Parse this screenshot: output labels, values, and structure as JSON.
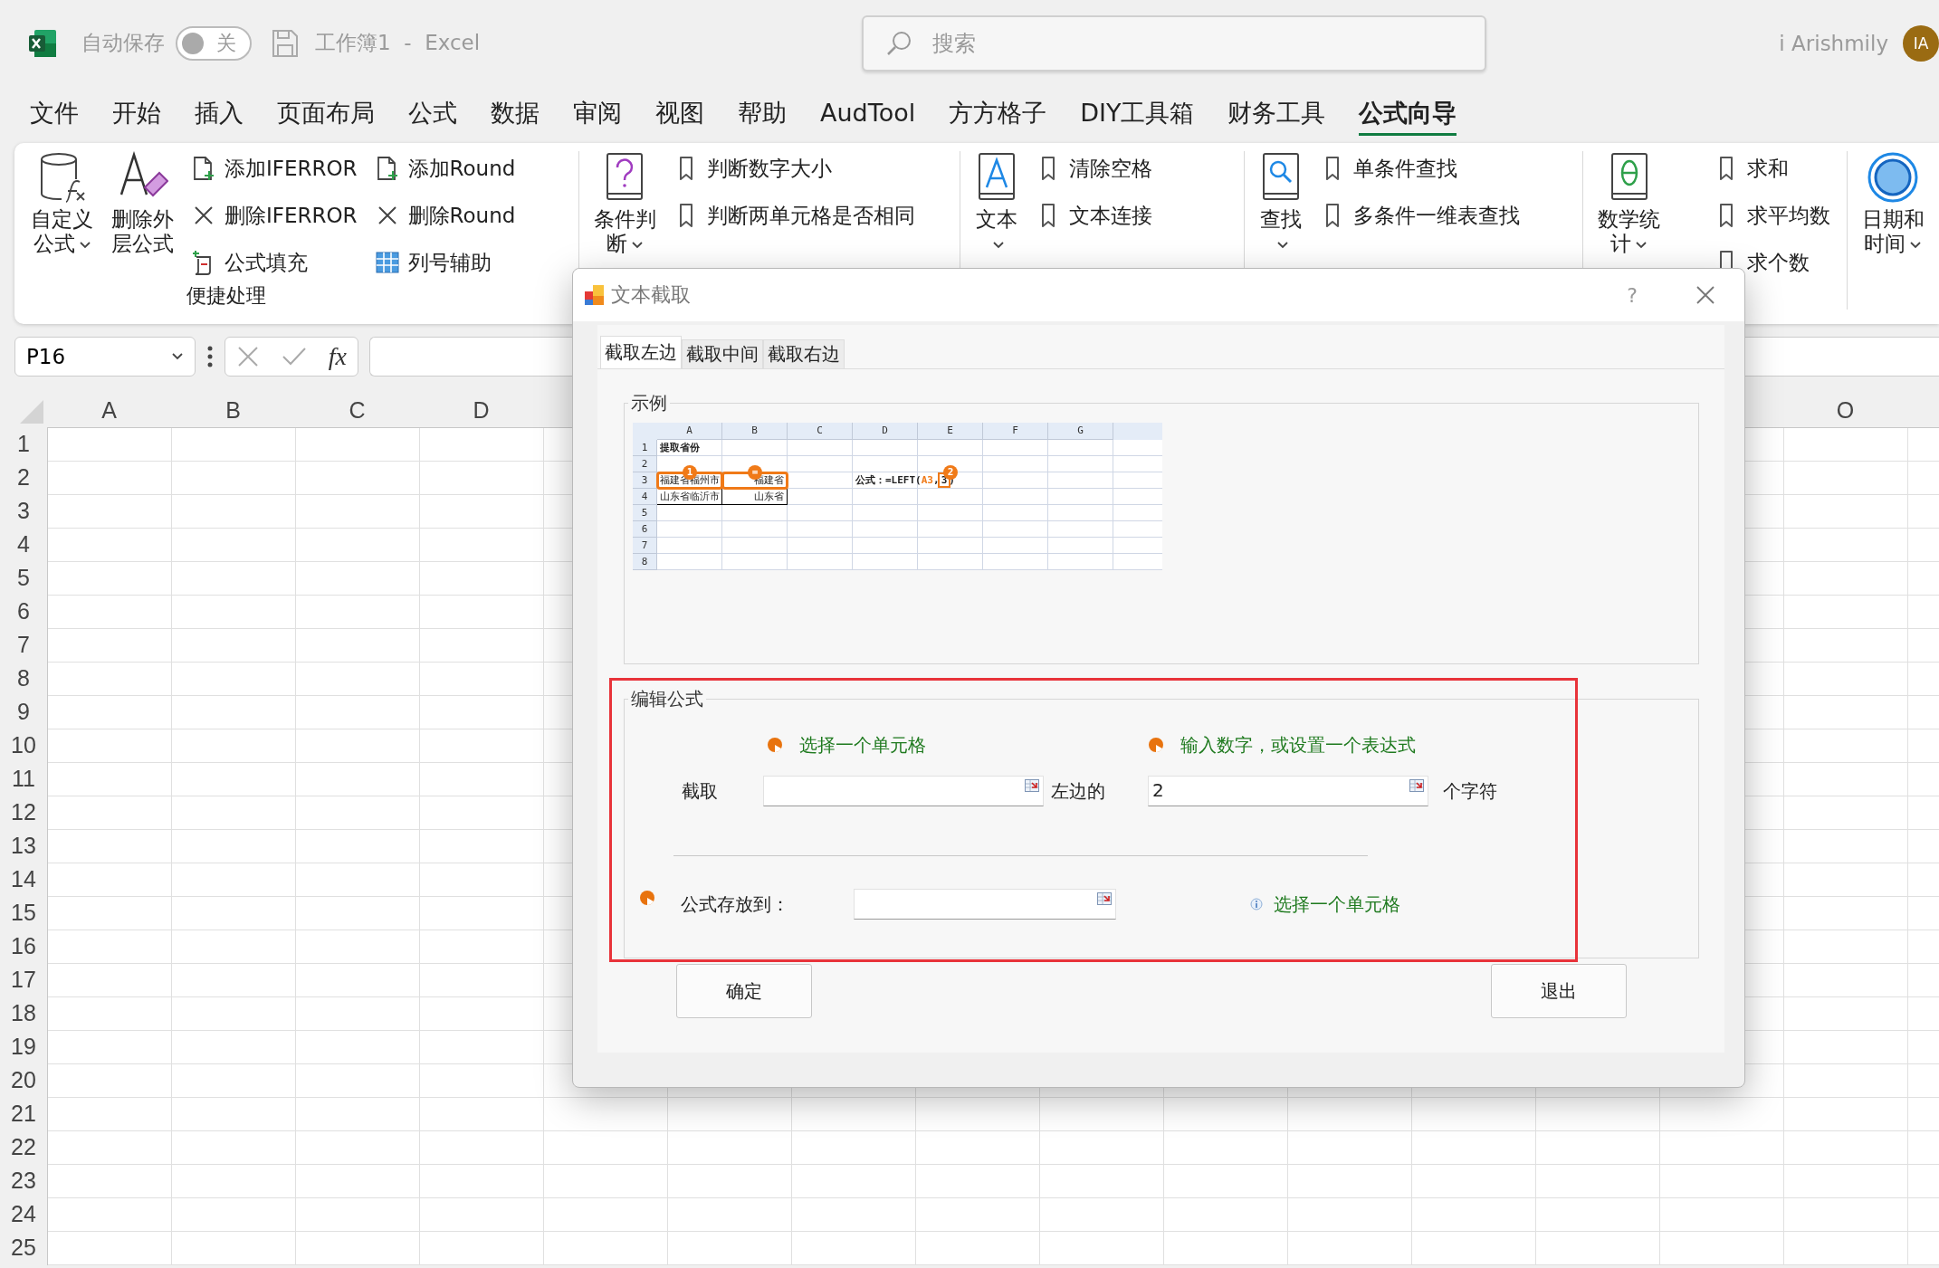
{
  "title_bar": {
    "autosave_label": "自动保存",
    "autosave": {
      "on": false,
      "label": "关"
    },
    "document_title": "工作簿1  -  Excel",
    "search": {
      "placeholder": "搜索"
    },
    "user_name": "i Arishmily",
    "avatar_initials": "IA"
  },
  "menu": [
    {
      "label": "文件",
      "selected": false
    },
    {
      "label": "开始",
      "selected": false
    },
    {
      "label": "插入",
      "selected": false
    },
    {
      "label": "页面布局",
      "selected": false
    },
    {
      "label": "公式",
      "selected": false
    },
    {
      "label": "数据",
      "selected": false
    },
    {
      "label": "审阅",
      "selected": false
    },
    {
      "label": "视图",
      "selected": false
    },
    {
      "label": "帮助",
      "selected": false
    },
    {
      "label": "AudTool",
      "selected": false
    },
    {
      "label": "方方格子",
      "selected": false
    },
    {
      "label": "DIY工具箱",
      "selected": false
    },
    {
      "label": "财务工具",
      "selected": false
    },
    {
      "label": "公式向导",
      "selected": true
    }
  ],
  "ribbon": [
    {
      "large": [
        {
          "lines": [
            "自定义",
            "公式"
          ],
          "dropdown": true
        },
        {
          "lines": [
            "删除外",
            "层公式"
          ],
          "dropdown": false
        }
      ],
      "small": [
        [
          "添加IFERROR",
          "删除IFERROR",
          "公式填充"
        ],
        [
          "添加Round",
          "删除Round",
          "列号辅助"
        ]
      ],
      "label": "便捷处理"
    },
    {
      "large": [
        {
          "lines": [
            "条件判",
            "断"
          ],
          "dropdown": true
        }
      ],
      "small": [
        [
          "判断数字大小",
          "判断两单元格是否相同"
        ]
      ]
    },
    {
      "large": [
        {
          "lines": [
            "文本"
          ],
          "dropdown": true
        }
      ],
      "small": [
        [
          "清除空格",
          "文本连接"
        ]
      ]
    },
    {
      "large": [
        {
          "lines": [
            "查找"
          ],
          "dropdown": true
        }
      ],
      "small": [
        [
          "单条件查找",
          "多条件一维表查找"
        ]
      ]
    },
    {
      "large": [
        {
          "lines": [
            "数学统",
            "计"
          ],
          "dropdown": true
        }
      ],
      "small": [
        [
          "求和",
          "求平均数",
          "求个数"
        ]
      ]
    },
    {
      "large": [
        {
          "lines": [
            "日期和",
            "时间"
          ],
          "dropdown": true
        }
      ]
    }
  ],
  "formula_bar": {
    "name_box": "P16",
    "function_symbol": "fx"
  },
  "sheet": {
    "columns": [
      {
        "label": "A"
      },
      {
        "label": "B"
      },
      {
        "label": "C"
      },
      {
        "label": "D"
      },
      {
        "label": "O"
      }
    ],
    "rows": [
      "1",
      "2",
      "3",
      "4",
      "5",
      "6",
      "7",
      "8",
      "9",
      "10",
      "11",
      "12",
      "13",
      "14",
      "15",
      "16",
      "17",
      "18",
      "19",
      "20",
      "21",
      "22",
      "23",
      "24",
      "25"
    ]
  },
  "dialog": {
    "title": "文本截取",
    "help": "?",
    "tabs": [
      {
        "label": "截取左边",
        "selected": true
      },
      {
        "label": "截取中间",
        "selected": false
      },
      {
        "label": "截取右边",
        "selected": false
      }
    ],
    "example": {
      "legend": "示例",
      "columns": [
        "A",
        "B",
        "C",
        "D",
        "E",
        "F",
        "G"
      ],
      "rows": [
        {
          "header": "1",
          "a": {
            "text": "提取省份",
            "kind": "title"
          }
        },
        {
          "header": "2",
          "a": {
            "marker": "1"
          },
          "b": {
            "marker": "="
          },
          "e": {
            "marker": "2"
          }
        },
        {
          "header": "3",
          "a": {
            "text": "福建省福州市",
            "kind": "data",
            "highlighted": true
          },
          "b": {
            "text": "福建省",
            "kind": "data",
            "highlighted": true
          },
          "d": {
            "kind": "formula",
            "formula": [
              {
                "text": "公式：=LEFT(",
                "kind": "plain"
              },
              {
                "text": "A3",
                "kind": "ref"
              },
              {
                "text": ",",
                "kind": "plain"
              },
              {
                "text": "3",
                "kind": "boxed"
              },
              {
                "text": ")",
                "kind": "plain"
              }
            ]
          }
        },
        {
          "header": "4",
          "a": {
            "text": "山东省临沂市",
            "kind": "data",
            "highlighted": false
          },
          "b": {
            "text": "山东省",
            "kind": "data",
            "highlighted": false
          }
        },
        {
          "header": "5"
        },
        {
          "header": "6"
        },
        {
          "header": "7"
        },
        {
          "header": "8"
        }
      ]
    },
    "edit": {
      "legend": "编辑公式",
      "hints": [
        "选择一个单元格",
        "输入数字，或设置一个表达式"
      ],
      "extract_label": "截取",
      "middle_label": "左边的",
      "count_value": "2",
      "suffix": "个字符",
      "output_label": "公式存放到：",
      "output_hint": "选择一个单元格"
    },
    "buttons": [
      "确定",
      "退出"
    ]
  }
}
